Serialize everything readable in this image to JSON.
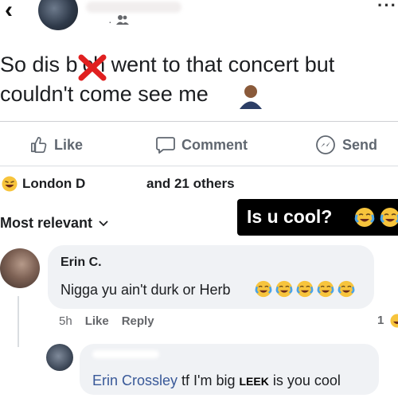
{
  "header": {
    "back_icon": "chevron-left-icon",
    "audience_icon": "friends-icon",
    "more_icon": "more-horizontal-icon"
  },
  "post": {
    "line1": "So dis b",
    "line1_rest": "ch went to that concert but",
    "line2": "couldn't come see me",
    "censor_mark": "✕",
    "emoji": "person-emoji"
  },
  "actions": {
    "like": "Like",
    "comment": "Comment",
    "send": "Send"
  },
  "reactions": {
    "names": "London D",
    "others": "and 21 others",
    "icon": "haha-icon"
  },
  "sort": {
    "label": "Most relevant",
    "icon": "chevron-down-icon"
  },
  "caption": {
    "text": "Is u cool?",
    "emoji_count": 2
  },
  "comment": {
    "author": "Erin C.",
    "text": "Nigga yu ain't durk or Herb",
    "emoji_count": 5,
    "time": "5h",
    "like": "Like",
    "reply": "Reply",
    "edge_count": "1"
  },
  "reply": {
    "mention": "Erin Crossley",
    "text_a": " tf I'm big ",
    "sticker": "LEEK",
    "text_b": " is you cool"
  },
  "colors": {
    "accent_link": "#385898",
    "bubble_bg": "#f0f2f5",
    "caption_bg": "#000000",
    "censor_red": "#e02020",
    "emoji_yellow": "#f7c43c"
  }
}
